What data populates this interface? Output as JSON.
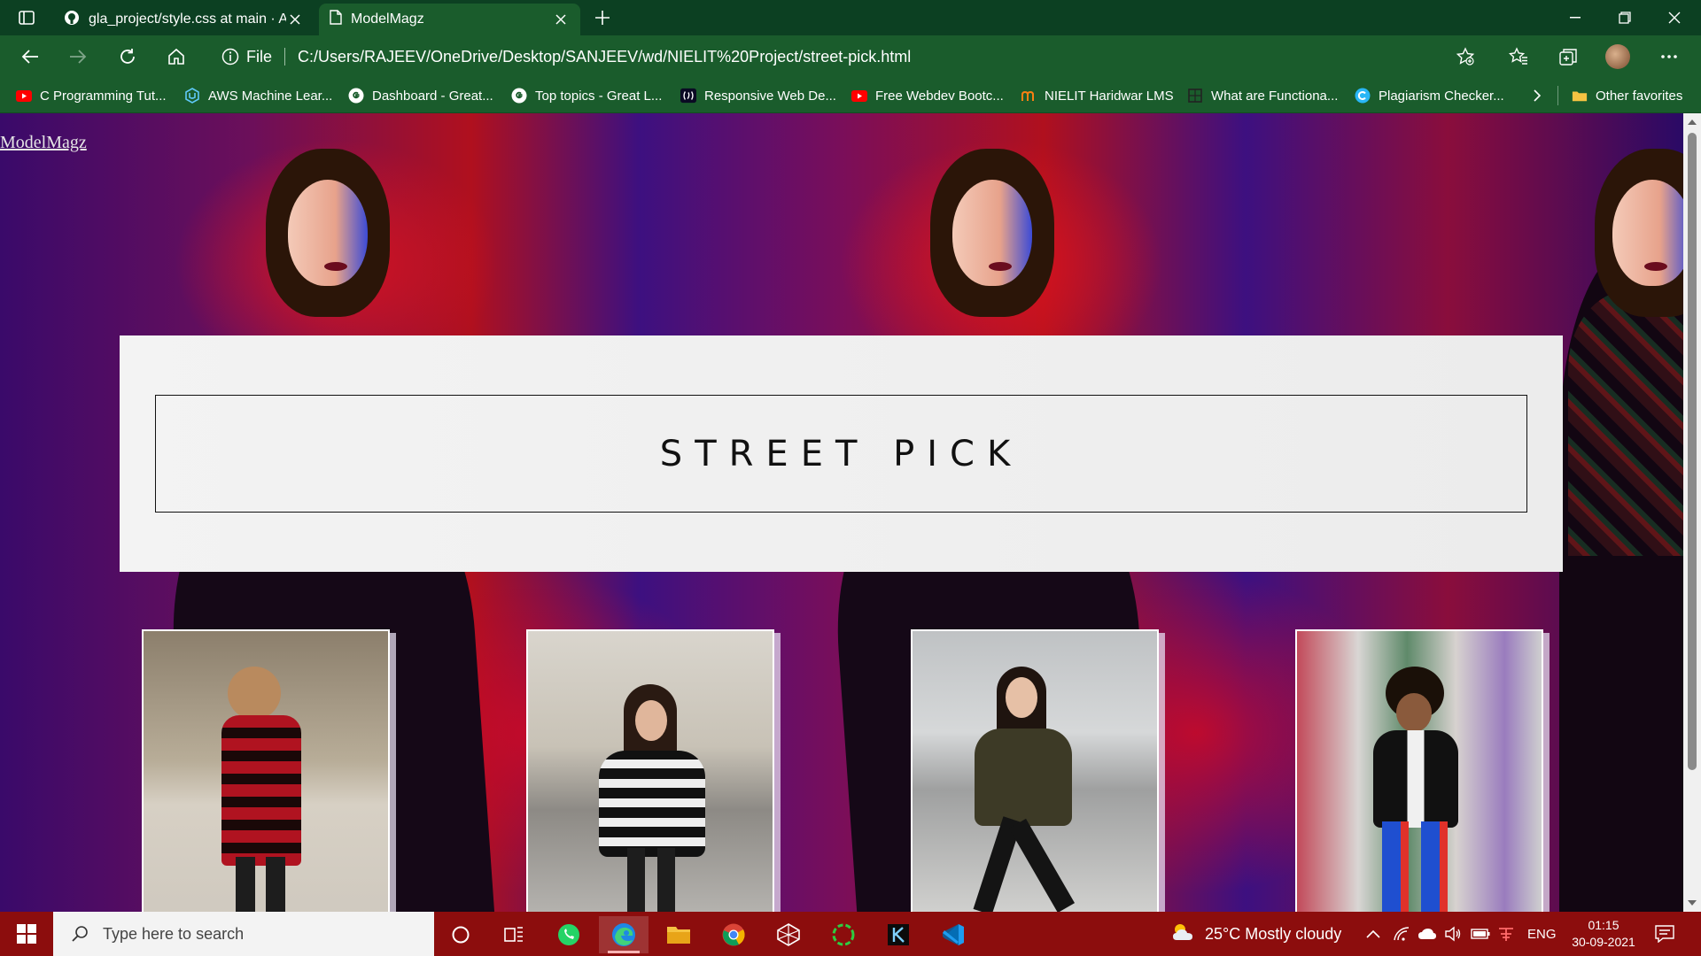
{
  "browser": {
    "tabs": [
      {
        "title": "gla_project/style.css at main · AMAN",
        "icon": "github-icon",
        "active": false
      },
      {
        "title": "ModelMagz",
        "icon": "page-icon",
        "active": true
      }
    ],
    "address": {
      "info_label": "File",
      "url": "C:/Users/RAJEEV/OneDrive/Desktop/SANJEEV/wd/NIELIT%20Project/street-pick.html"
    },
    "bookmarks": [
      {
        "label": "C Programming Tut...",
        "icon": "youtube-icon"
      },
      {
        "label": "AWS Machine Lear...",
        "icon": "udacity-icon"
      },
      {
        "label": "Dashboard - Great...",
        "icon": "google-icon"
      },
      {
        "label": "Top topics - Great L...",
        "icon": "google-icon"
      },
      {
        "label": "Responsive Web De...",
        "icon": "freecodecamp-icon"
      },
      {
        "label": "Free Webdev Bootc...",
        "icon": "youtube-icon"
      },
      {
        "label": "NIELIT Haridwar LMS",
        "icon": "moodle-icon"
      },
      {
        "label": "What are Functiona...",
        "icon": "site-icon"
      },
      {
        "label": "Plagiarism Checker...",
        "icon": "checker-icon"
      }
    ],
    "other_favorites": "Other favorites"
  },
  "page": {
    "site_link": "ModelMagz",
    "hero_title": "STREET PICK",
    "photos": [
      {
        "alt": "red plaid coat",
        "icon": "street-photo-1"
      },
      {
        "alt": "striped fur coat",
        "icon": "street-photo-2"
      },
      {
        "alt": "olive bomber jacket",
        "icon": "street-photo-3"
      },
      {
        "alt": "track jacket",
        "icon": "street-photo-4"
      }
    ]
  },
  "taskbar": {
    "search_placeholder": "Type here to search",
    "weather": "25°C  Mostly cloudy",
    "language": "ENG",
    "time": "01:15",
    "date": "30-09-2021"
  },
  "colors": {
    "titlebar": "#0c4022",
    "toolbar": "#1a5c2c",
    "taskbar": "#8c0d0d"
  }
}
